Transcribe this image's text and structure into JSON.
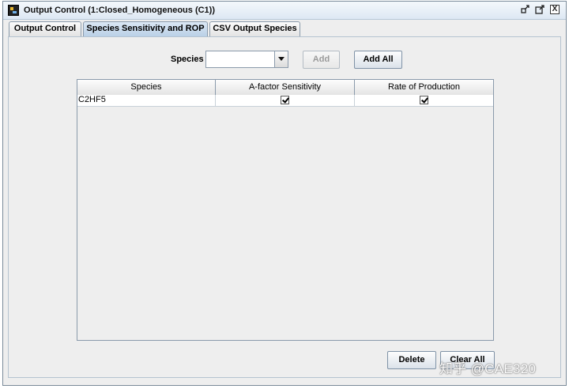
{
  "window": {
    "title": "Output Control  (1:Closed_Homogeneous (C1))",
    "controls": {
      "restore_icon": "restore-icon",
      "maximize_icon": "maximize-icon",
      "close_label": "X"
    }
  },
  "tabs": [
    {
      "label": "Output Control",
      "active": false
    },
    {
      "label": "Species Sensitivity and ROP",
      "active": true
    },
    {
      "label": "CSV Output Species",
      "active": false
    }
  ],
  "species_selector": {
    "label": "Species",
    "value": "",
    "add_label": "Add",
    "add_enabled": false,
    "add_all_label": "Add All"
  },
  "table": {
    "columns": [
      "Species",
      "A-factor Sensitivity",
      "Rate of Production"
    ],
    "rows": [
      {
        "species": "C2HF5",
        "a_factor_sensitivity": true,
        "rate_of_production": true
      }
    ]
  },
  "actions": {
    "delete_label": "Delete",
    "clear_all_label": "Clear All"
  },
  "watermark": "知乎 @CAE320"
}
